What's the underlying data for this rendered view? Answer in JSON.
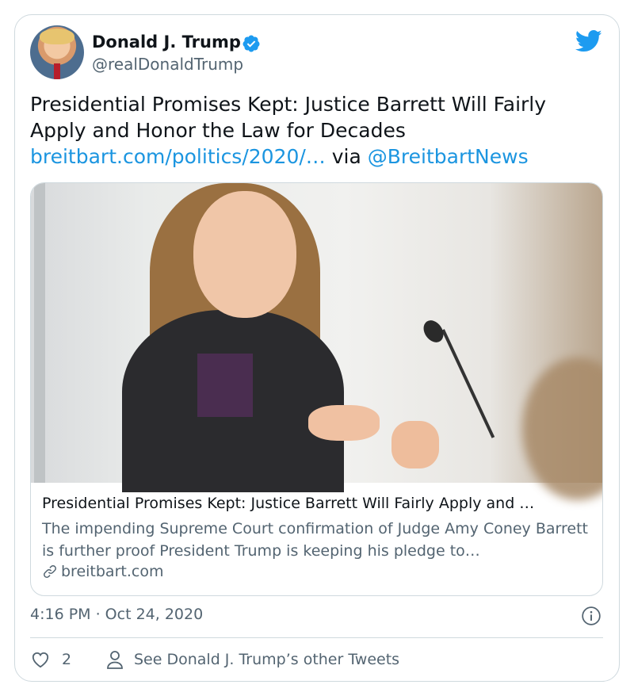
{
  "author": {
    "display_name": "Donald J. Trump",
    "handle": "@realDonaldTrump"
  },
  "tweet": {
    "text_line": "Presidential Promises Kept: Justice Barrett Will Fairly Apply and Honor the Law for Decades",
    "link_text": "breitbart.com/politics/2020/…",
    "via_text": "via",
    "mention": "@BreitbartNews"
  },
  "card": {
    "title": "Presidential Promises Kept: Justice Barrett Will Fairly Apply and …",
    "description": "The impending Supreme Court confirmation of Judge Amy Coney Barrett is further proof President Trump is keeping his pledge to…",
    "domain": "breitbart.com"
  },
  "meta": {
    "timestamp": "4:16 PM · Oct 24, 2020"
  },
  "actions": {
    "like_count": "2",
    "other_tweets_label": "See Donald J. Trump’s other Tweets"
  },
  "colors": {
    "accent": "#1b95e0",
    "secondary_text": "#536471",
    "border": "#cfd9de"
  },
  "icons": [
    "verified-badge-icon",
    "twitter-bird-icon",
    "link-icon",
    "info-icon",
    "heart-icon",
    "profile-icon"
  ]
}
